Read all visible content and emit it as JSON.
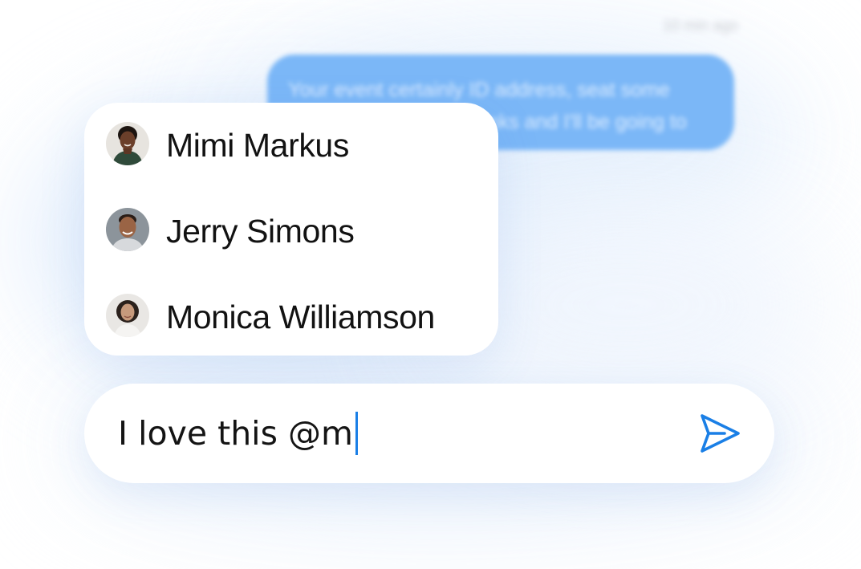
{
  "background": {
    "timestamp": "10 min ago",
    "message_bubble": {
      "text": "Your event certainly ID address, seat some really cool in house drinks and I'll be going to",
      "color": "#7bb7f7"
    }
  },
  "mention_popup": {
    "items": [
      {
        "name": "Mimi Markus",
        "avatar": "avatar-woman-dark-hair"
      },
      {
        "name": "Jerry Simons",
        "avatar": "avatar-man-smiling"
      },
      {
        "name": "Monica Williamson",
        "avatar": "avatar-woman-curly-hair"
      }
    ]
  },
  "composer": {
    "value": "I love this @m",
    "send_icon": "send-icon",
    "accent_color": "#1a7fe6"
  }
}
